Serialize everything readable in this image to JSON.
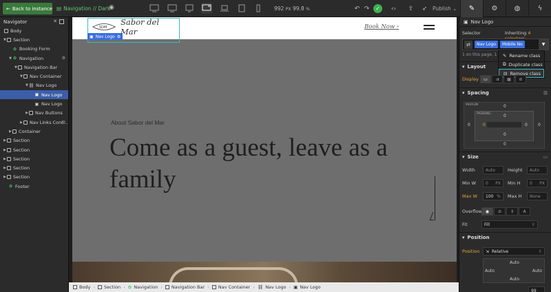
{
  "topbar": {
    "back_label": "Back to instance",
    "page_label": "Navigation // Dark",
    "canvas_width": "992",
    "canvas_unit": "PX",
    "zoom": "99.8",
    "zoom_unit": "%",
    "publish_label": "Publish"
  },
  "navigator": {
    "title": "Navigator",
    "items": [
      {
        "label": "Body"
      },
      {
        "label": "Section"
      },
      {
        "label": "Booking Form"
      },
      {
        "label": "Navigation"
      },
      {
        "label": "Navigation Bar"
      },
      {
        "label": "Nav Container"
      },
      {
        "label": "Nav Logo"
      },
      {
        "label": "Nav Logo"
      },
      {
        "label": "Nav Logo"
      },
      {
        "label": "Nav Buttons"
      },
      {
        "label": "Nav Links Cont..."
      },
      {
        "label": "Container"
      },
      {
        "label": "Section"
      },
      {
        "label": "Section"
      },
      {
        "label": "Section"
      },
      {
        "label": "Section"
      },
      {
        "label": "Section"
      },
      {
        "label": "Footer"
      }
    ]
  },
  "canvas": {
    "logo_emblem": "SDM",
    "logo_text": "Sabor del Mar",
    "selected_label": "Nav Logo",
    "book_now": "Book Now",
    "book_now_arrow": "›",
    "eyebrow": "About Sabor del Mar",
    "hero_line1": "Come as a guest, leave as a",
    "hero_line2": "family"
  },
  "breadcrumb": [
    "Body",
    "Section",
    "Navigation",
    "Navigation Bar",
    "Nav Container",
    "Nav Logo",
    "Nav Logo"
  ],
  "style_panel": {
    "element_name": "Nav Logo",
    "selector_label": "Selector",
    "inheriting_prefix": "Inheriting",
    "inheriting_count": "4 selectors",
    "tags": [
      "Nav Logo",
      "Mobile No"
    ],
    "on_page": "1 on this page, 1",
    "context_menu": [
      "Rename class",
      "Duplicate class",
      "Remove class"
    ],
    "layout": {
      "title": "Layout",
      "display_label": "Display"
    },
    "spacing": {
      "title": "Spacing",
      "margin_label": "MARGIN",
      "padding_label": "PADDING",
      "margin_top": "0",
      "margin_right": "0",
      "margin_bottom": "0",
      "margin_left": "0",
      "padding_top": "0",
      "padding_right": "0",
      "padding_bottom": "0",
      "padding_left": "0"
    },
    "size": {
      "title": "Size",
      "width_label": "Width",
      "width_value": "Auto",
      "height_label": "Height",
      "height_value": "Auto",
      "minw_label": "Min W",
      "minw_value": "0",
      "minw_unit": "PX",
      "minh_label": "Min H",
      "minh_value": "0",
      "minh_unit": "PX",
      "maxw_label": "Max W",
      "maxw_value": "100",
      "maxw_unit": "%",
      "maxh_label": "Max H",
      "maxh_value": "None",
      "overflow_label": "Overflow",
      "fit_label": "Fit",
      "fit_value": "Fill"
    },
    "position": {
      "title": "Position",
      "position_label": "Position",
      "position_value": "Relative",
      "top": "Auto",
      "left": "Auto",
      "right": "Auto",
      "bottom": "Auto",
      "z_value": "99"
    }
  },
  "colors": {
    "accent_blue": "#3b6fdc",
    "selection_teal": "#37b9c6",
    "status_green": "#3fb04f",
    "warning_orange": "#e8a33d"
  }
}
